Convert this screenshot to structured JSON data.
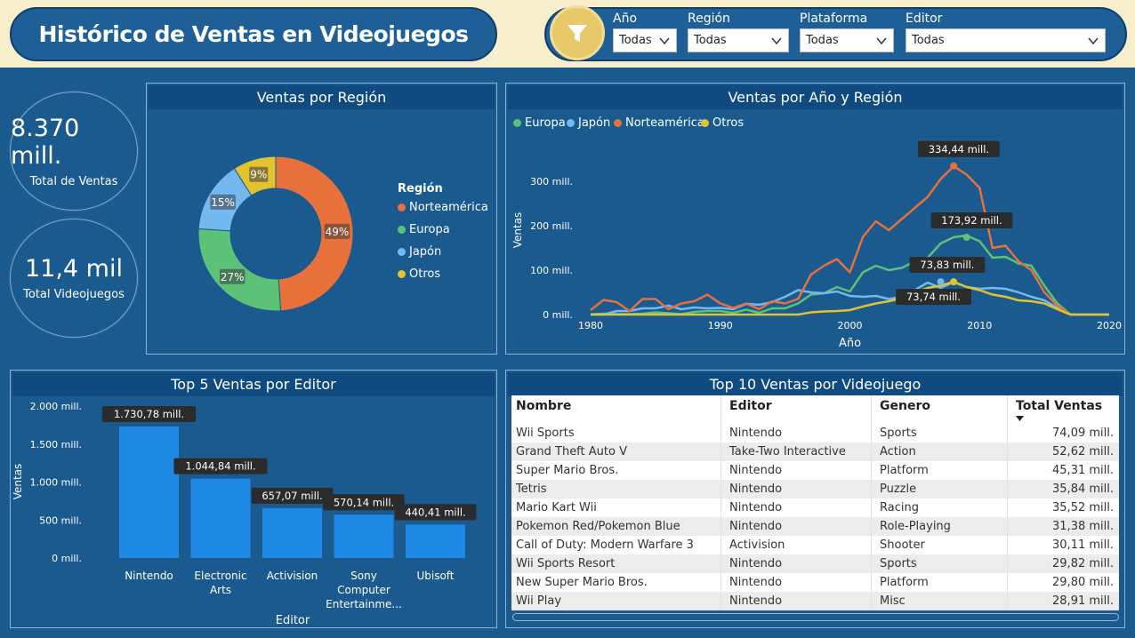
{
  "header": {
    "title": "Histórico de Ventas en Videojuegos"
  },
  "filters": [
    {
      "label": "Año",
      "value": "Todas"
    },
    {
      "label": "Región",
      "value": "Todas"
    },
    {
      "label": "Plataforma",
      "value": "Todas"
    },
    {
      "label": "Editor",
      "value": "Todas"
    }
  ],
  "kpis": {
    "total_sales": {
      "value": "8.370 mill.",
      "caption": "Total de Ventas"
    },
    "total_games": {
      "value": "11,4 mil",
      "caption": "Total Videojuegos"
    }
  },
  "colors": {
    "norteamerica": "#e8703a",
    "europa": "#5cc278",
    "japon": "#74b8f0",
    "otros": "#e3c22f",
    "bar": "#1e88e5"
  },
  "region_panel": {
    "title": "Ventas por Región",
    "legend_title": "Región"
  },
  "year_panel": {
    "title": "Ventas por Año y Región",
    "xlabel": "Año",
    "ylabel": "Ventas"
  },
  "publisher_panel": {
    "title": "Top 5 Ventas por Editor",
    "xlabel": "Editor",
    "ylabel": "Ventas"
  },
  "table_panel": {
    "title": "Top 10 Ventas por Videojuego",
    "columns": [
      "Nombre",
      "Editor",
      "Genero",
      "Total Ventas"
    ],
    "rows": [
      [
        "Wii Sports",
        "Nintendo",
        "Sports",
        "74,09 mill."
      ],
      [
        "Grand Theft Auto V",
        "Take-Two Interactive",
        "Action",
        "52,62 mill."
      ],
      [
        "Super Mario Bros.",
        "Nintendo",
        "Platform",
        "45,31 mill."
      ],
      [
        "Tetris",
        "Nintendo",
        "Puzzle",
        "35,84 mill."
      ],
      [
        "Mario Kart Wii",
        "Nintendo",
        "Racing",
        "35,52 mill."
      ],
      [
        "Pokemon Red/Pokemon Blue",
        "Nintendo",
        "Role-Playing",
        "31,38 mill."
      ],
      [
        "Call of Duty: Modern Warfare 3",
        "Activision",
        "Shooter",
        "30,11 mill."
      ],
      [
        "Wii Sports Resort",
        "Nintendo",
        "Sports",
        "29,82 mill."
      ],
      [
        "New Super Mario Bros.",
        "Nintendo",
        "Platform",
        "29,80 mill."
      ],
      [
        "Wii Play",
        "Nintendo",
        "Misc",
        "28,91 mill."
      ]
    ]
  },
  "chart_data": [
    {
      "type": "pie",
      "title": "Ventas por Región",
      "legend_title": "Región",
      "legend": "right",
      "slices": [
        {
          "name": "Norteamérica",
          "value": 49,
          "label": "49%"
        },
        {
          "name": "Europa",
          "value": 27,
          "label": "27%"
        },
        {
          "name": "Japón",
          "value": 15,
          "label": "15%"
        },
        {
          "name": "Otros",
          "value": 9,
          "label": "9%"
        }
      ]
    },
    {
      "type": "line",
      "title": "Ventas por Año y Región",
      "xlabel": "Año",
      "ylabel": "Ventas",
      "xlim": [
        1980,
        2020
      ],
      "ylim": [
        0,
        350
      ],
      "xticks": [
        1980,
        1990,
        2000,
        2010,
        2020
      ],
      "yticks": [
        0,
        100,
        200,
        300
      ],
      "ytick_labels": [
        "0 mill.",
        "100 mill.",
        "200 mill.",
        "300 mill."
      ],
      "legend": "top-left",
      "x": [
        1980,
        1981,
        1982,
        1983,
        1984,
        1985,
        1986,
        1987,
        1988,
        1989,
        1990,
        1991,
        1992,
        1993,
        1994,
        1995,
        1996,
        1997,
        1998,
        1999,
        2000,
        2001,
        2002,
        2003,
        2004,
        2005,
        2006,
        2007,
        2008,
        2009,
        2010,
        2011,
        2012,
        2013,
        2014,
        2015,
        2016,
        2017,
        2018,
        2019,
        2020
      ],
      "series": [
        {
          "name": "Europa",
          "values": [
            0.5,
            2,
            1,
            1,
            2,
            5,
            3,
            1,
            6,
            8,
            8,
            4,
            11,
            4,
            14,
            14,
            25,
            45,
            48,
            62,
            52,
            95,
            110,
            100,
            105,
            120,
            128,
            160,
            174,
            178,
            165,
            128,
            130,
            115,
            110,
            65,
            25,
            0,
            0,
            0,
            0
          ]
        },
        {
          "name": "Japón",
          "values": [
            0,
            0,
            8,
            8,
            14,
            14,
            20,
            12,
            16,
            14,
            15,
            12,
            24,
            22,
            28,
            40,
            55,
            50,
            48,
            52,
            42,
            40,
            42,
            35,
            40,
            55,
            72,
            60,
            73,
            62,
            58,
            60,
            58,
            50,
            40,
            32,
            15,
            0,
            0,
            0,
            0
          ]
        },
        {
          "name": "Norteamérica",
          "values": [
            10,
            33,
            28,
            8,
            35,
            35,
            12,
            25,
            30,
            45,
            25,
            15,
            25,
            12,
            30,
            25,
            35,
            90,
            110,
            125,
            95,
            175,
            210,
            190,
            215,
            240,
            265,
            305,
            334,
            315,
            285,
            150,
            155,
            120,
            100,
            50,
            20,
            0,
            0,
            0,
            0
          ]
        },
        {
          "name": "Otros",
          "values": [
            0,
            0,
            0,
            0,
            0,
            0,
            0,
            0,
            0,
            0,
            0,
            0,
            0,
            0,
            0,
            0,
            0,
            5,
            7,
            8,
            10,
            18,
            25,
            30,
            37,
            50,
            60,
            65,
            73.74,
            62,
            55,
            45,
            40,
            32,
            30,
            25,
            12,
            0,
            0,
            0,
            0
          ]
        }
      ],
      "annotations": [
        {
          "series": "Norteamérica",
          "x": 2008,
          "y": 334.44,
          "label": "334,44 mill."
        },
        {
          "series": "Europa",
          "x": 2009,
          "y": 173.92,
          "label": "173,92 mill."
        },
        {
          "series": "Japón",
          "x": 2007,
          "y": 73.83,
          "label": "73,83 mill."
        },
        {
          "series": "Otros",
          "x": 2008,
          "y": 73.74,
          "label": "73,74 mill."
        }
      ]
    },
    {
      "type": "bar",
      "title": "Top 5 Ventas por Editor",
      "xlabel": "Editor",
      "ylabel": "Ventas",
      "ylim": [
        0,
        2000
      ],
      "yticks": [
        0,
        500,
        1000,
        1500,
        2000
      ],
      "ytick_labels": [
        "0 mill.",
        "500 mill.",
        "1.000 mill.",
        "1.500 mill.",
        "2.000 mill."
      ],
      "categories": [
        "Nintendo",
        "Electronic Arts",
        "Activision",
        "Sony Computer Entertainme...",
        "Ubisoft"
      ],
      "category_lines": [
        [
          "Nintendo"
        ],
        [
          "Electronic",
          "Arts"
        ],
        [
          "Activision"
        ],
        [
          "Sony",
          "Computer",
          "Entertainme..."
        ],
        [
          "Ubisoft"
        ]
      ],
      "values": [
        1730.78,
        1044.84,
        657.07,
        570.14,
        440.41
      ],
      "labels": [
        "1.730,78 mill.",
        "1.044,84 mill.",
        "657,07 mill.",
        "570,14 mill.",
        "440,41 mill."
      ]
    }
  ]
}
